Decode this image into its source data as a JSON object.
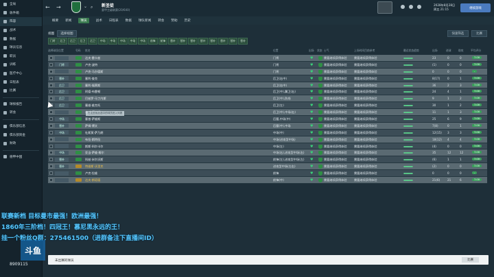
{
  "sidebar": {
    "items": [
      {
        "label": "全局"
      },
      {
        "label": "收件箱"
      },
      {
        "label": "阵容"
      },
      {
        "label": "战术"
      },
      {
        "label": "数据"
      },
      {
        "label": "球员信息"
      },
      {
        "label": "职员"
      },
      {
        "label": "训练"
      },
      {
        "label": "医疗中心"
      },
      {
        "label": "日程表"
      },
      {
        "label": "比赛"
      },
      {
        "label": "球探报告"
      },
      {
        "label": "转会"
      },
      {
        "label": "俱乐部信息"
      },
      {
        "label": "俱乐部资金"
      },
      {
        "label": "财政"
      },
      {
        "label": "德甲中国"
      }
    ]
  },
  "header": {
    "club_name": "新圣徒",
    "club_subtitle": "意甲主级联赛(20/640)",
    "date_line1": "2028年8月28日",
    "date_line2": "周五 21:15",
    "continue_label": "继续游戏"
  },
  "tabs": [
    "概要",
    "新闻",
    "球员",
    "战术",
    "日程表",
    "数据",
    "球队新闻",
    "转会",
    "赞助",
    "历史"
  ],
  "active_tab": "球员",
  "toolbar": {
    "view_label": "视图",
    "select_label": "选择视图",
    "filter_label": "快速筛选",
    "compare_label": "比赛"
  },
  "positions": [
    "门将",
    "后卫",
    "后卫",
    "后卫",
    "后卫",
    "中场",
    "中场",
    "中场",
    "中场",
    "中场",
    "前锋",
    "前锋",
    "替补",
    "替补",
    "替补",
    "替补",
    "替补",
    "替补",
    "替补",
    "替补"
  ],
  "columns": [
    "选择球员位置",
    "号码",
    "姓名",
    "位置",
    "出场",
    "状态",
    "士气",
    "上场时间目前参考",
    "最近状态趋势",
    "出场",
    "进球",
    "助攻",
    "平均评分"
  ],
  "players": [
    {
      "slot": "",
      "name": "达夫·雷卡兹",
      "pos": "门将",
      "morale": "需要继续获得体验",
      "playtime": "需要继续获得体验",
      "apps": "23",
      "goals": "0",
      "assists": "0",
      "rating": "7.00"
    },
    {
      "slot": "门将",
      "name": "卢克·波特",
      "pos": "门将",
      "morale": "需要继续获得体验",
      "playtime": "需要继续获得体验",
      "apps": "(1)",
      "goals": "0",
      "assists": "0",
      "rating": "7.00"
    },
    {
      "slot": "",
      "name": "卢克·马尔德斯",
      "pos": "门将",
      "morale": "需要继续获得体验",
      "playtime": "需要继续获得体验",
      "apps": "0",
      "goals": "0",
      "assists": "0",
      "rating": "-"
    },
    {
      "slot": "替补",
      "name": "塞利·查克",
      "pos": "后卫(右中)",
      "morale": "需要继续获得体验",
      "playtime": "需要继续获得体验",
      "apps": "8(17)",
      "goals": "0",
      "assists": "1",
      "rating": "7.00"
    },
    {
      "slot": "后卫",
      "name": "塞利·福莱斯",
      "pos": "后卫(右中)",
      "morale": "需要继续获得体验",
      "playtime": "需要继续获得体验",
      "apps": "36",
      "goals": "2",
      "assists": "3",
      "rating": "7.00"
    },
    {
      "slot": "后卫",
      "name": "阿德·布雷顿",
      "pos": "后卫(中),翼卫(右)",
      "morale": "需要继续获得体验",
      "playtime": "需要继续获得体验",
      "apps": "24",
      "goals": "4",
      "assists": "1",
      "rating": "7.00"
    },
    {
      "slot": "后卫",
      "name": "巴兹罗·马丁内斯",
      "pos": "后卫(中),防线",
      "morale": "需要继续获得体验",
      "playtime": "需要继续获得体验",
      "apps": "9",
      "goals": "1",
      "assists": "2",
      "rating": "7.00"
    },
    {
      "slot": "后卫",
      "name": "塞维·维克托",
      "pos": "后卫(左)",
      "morale": "需要继续获得体验",
      "playtime": "需要继续获得体验",
      "apps": "30",
      "goals": "1",
      "assists": "2",
      "rating": "7.00"
    },
    {
      "slot": "",
      "name": "本·查德特斯",
      "pos": "后卫(中),中场(右)",
      "morale": "需要继续获得体验",
      "playtime": "需要继续获得体验",
      "apps": "11",
      "goals": "1",
      "assists": "3",
      "rating": "7.00"
    },
    {
      "slot": "中场",
      "name": "塞普·萨维斯",
      "pos": "后腰,中场(中)",
      "morale": "需要继续获得体验",
      "playtime": "需要继续获得体验",
      "apps": "25",
      "goals": "6",
      "assists": "9",
      "rating": "7.00"
    },
    {
      "slot": "替补",
      "name": "萨姆·博文",
      "pos": "后腰(中),中场",
      "morale": "需要继续获得体验",
      "playtime": "需要继续获得体验",
      "apps": "7(8)",
      "goals": "0",
      "assists": "1",
      "rating": "7.00"
    },
    {
      "slot": "中场",
      "name": "杜斯莫·萨乃朗",
      "pos": "中场(中)",
      "morale": "需要继续获得体验",
      "playtime": "需要继续获得体验",
      "apps": "12(15)",
      "goals": "3",
      "assists": "3",
      "rating": "7.00"
    },
    {
      "slot": "",
      "name": "布拉·斯特拉",
      "pos": "中场(进攻型中场)",
      "morale": "需要继续获得体验",
      "playtime": "需要继续获得体验",
      "apps": "18(12)",
      "goals": "4",
      "assists": "4",
      "rating": "7.00"
    },
    {
      "slot": "",
      "name": "斯斯·科尔卡尔",
      "pos": "中场(左)",
      "morale": "需要继续获得体验",
      "playtime": "需要继续获得体验",
      "apps": "(4)",
      "goals": "0",
      "assists": "0",
      "rating": "7.00"
    },
    {
      "slot": "中场",
      "name": "亚当·萨维·格尔",
      "pos": "中场(右),进攻型中场(右)",
      "morale": "需要继续获得体验",
      "playtime": "需要继续获得体验",
      "apps": "35",
      "goals": "12",
      "assists": "12",
      "rating": "7.00"
    },
    {
      "slot": "替补",
      "name": "科兹·米尔沃斯",
      "pos": "前锋(左),进攻型中场(左)",
      "morale": "需要继续获得体验",
      "playtime": "需要继续获得体验",
      "apps": "(6)",
      "goals": "1",
      "assists": "1",
      "rating": "7.00"
    },
    {
      "slot": "替补",
      "name": "特维斯·沃里克",
      "pos": "进攻型中场(左右)",
      "morale": "需要继续获得体验",
      "playtime": "需要继续获得体验",
      "apps": "(2)",
      "goals": "0",
      "assists": "0",
      "rating": "7.00"
    },
    {
      "slot": "",
      "name": "卢克·拉维",
      "pos": "前锋",
      "morale": "需要继续获得体验",
      "playtime": "需要继续获得体验",
      "apps": "0",
      "goals": "0",
      "assists": "0",
      "rating": "-"
    },
    {
      "slot": "",
      "name": "达夫·斯塔德",
      "pos": "前锋(中)",
      "morale": "需要继续获得体验",
      "playtime": "需要继续获得体验",
      "apps": "21(6)",
      "goals": "21",
      "assists": "6",
      "rating": "7.00"
    }
  ],
  "bottom": {
    "label": "未出赛的球员",
    "select": "比赛"
  },
  "stream": {
    "line1": "联赛新档 目标曼市最强！欧洲最强！",
    "line2": "1860年三阶档！四冠王！慕尼黑永远的王！",
    "line3": "挂一个粉丝Q群：275461500（进群备注下直播间ID）",
    "logo": "斗鱼",
    "room_id": "8909115"
  },
  "tooltip": "在这里拖放选中的球员进入列表"
}
